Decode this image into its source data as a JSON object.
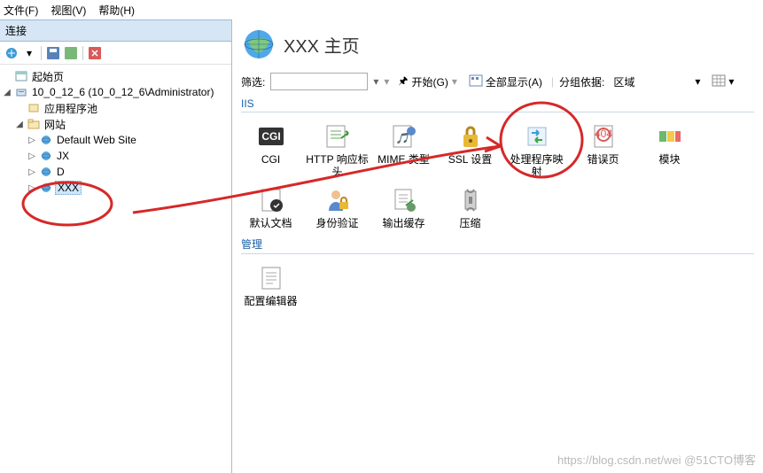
{
  "menu": {
    "file": "文件(F)",
    "view": "视图(V)",
    "help": "帮助(H)"
  },
  "sidebar": {
    "header": "连接",
    "nodes": {
      "start": "起始页",
      "server": "10_0_12_6 (10_0_12_6\\Administrator)",
      "apppools": "应用程序池",
      "sites": "网站",
      "site0": "Default Web Site",
      "site1": "JX",
      "site2": "D",
      "site3": "XXX"
    }
  },
  "page": {
    "title": "XXX 主页"
  },
  "filter": {
    "label": "筛选:",
    "start": "开始(G)",
    "showall": "全部显示(A)",
    "groupby": "分组依据:",
    "groupval": "区域"
  },
  "sections": {
    "iis": "IIS",
    "mgmt": "管理"
  },
  "iis": {
    "cgi": "CGI",
    "http": "HTTP 响应标头",
    "mime": "MIME 类型",
    "ssl": "SSL 设置",
    "handler": "处理程序映射",
    "err": "错误页",
    "module": "模块",
    "defdoc": "默认文档",
    "auth": "身份验证",
    "cache": "输出缓存",
    "compress": "压缩"
  },
  "mgmt": {
    "confed": "配置编辑器"
  },
  "watermark": "https://blog.csdn.net/wei @51CTO博客"
}
